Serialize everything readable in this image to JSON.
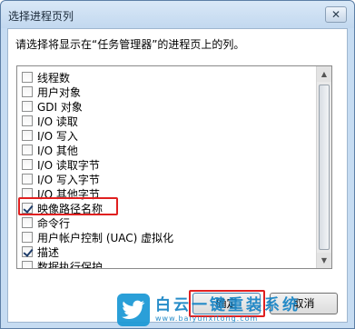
{
  "window": {
    "title": "选择进程页列",
    "close_label": "✕"
  },
  "instruction": "请选择将显示在“任务管理器”的进程页上的列。",
  "columns": [
    {
      "label": "线程数",
      "checked": false
    },
    {
      "label": "用户对象",
      "checked": false
    },
    {
      "label": "GDI 对象",
      "checked": false
    },
    {
      "label": "I/O 读取",
      "checked": false
    },
    {
      "label": "I/O 写入",
      "checked": false
    },
    {
      "label": "I/O 其他",
      "checked": false
    },
    {
      "label": "I/O 读取字节",
      "checked": false
    },
    {
      "label": "I/O 写入字节",
      "checked": false
    },
    {
      "label": "I/O 其他字节",
      "checked": false
    },
    {
      "label": "映像路径名称",
      "checked": true
    },
    {
      "label": "命令行",
      "checked": false
    },
    {
      "label": "用户帐户控制 (UAC) 虚拟化",
      "checked": false
    },
    {
      "label": "描述",
      "checked": true
    },
    {
      "label": "数据执行保护",
      "checked": false
    }
  ],
  "buttons": {
    "ok": "确定",
    "cancel": "取消"
  },
  "watermark": {
    "brand": "白云一键重装系统",
    "url": "www.baiyunxitong.com"
  },
  "colors": {
    "highlight": "#e02020",
    "title_bar": "#c6dcf2",
    "watermark": "#1b86c6"
  }
}
